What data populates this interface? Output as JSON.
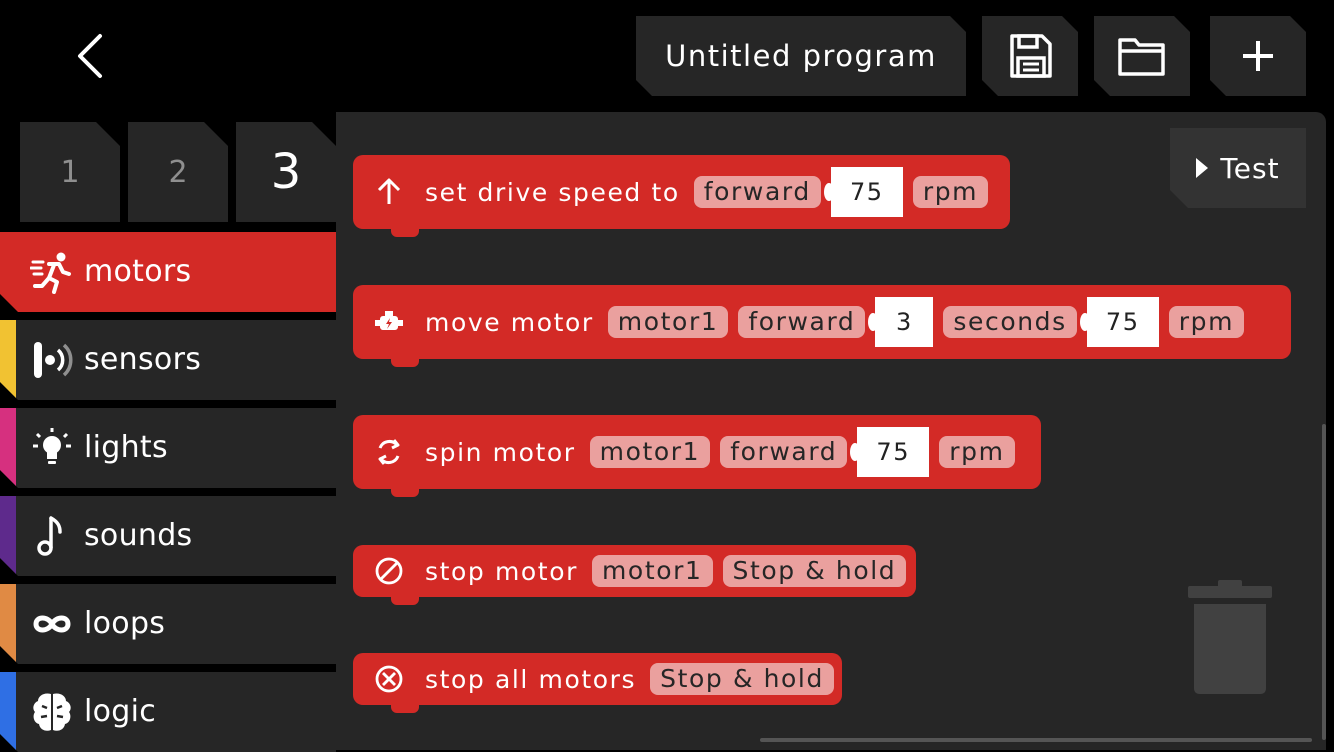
{
  "header": {
    "back_icon": "chevron-left-icon",
    "title": "Untitled program",
    "save_icon": "floppy-disk-icon",
    "open_icon": "folder-icon",
    "new_icon": "plus-icon"
  },
  "pages": [
    {
      "label": "1",
      "active": false
    },
    {
      "label": "2",
      "active": false
    },
    {
      "label": "3",
      "active": true
    }
  ],
  "categories": [
    {
      "label": "motors",
      "icon": "runner-icon",
      "color": "#d32a26",
      "active": true
    },
    {
      "label": "sensors",
      "icon": "sensor-icon",
      "color": "#f1c232"
    },
    {
      "label": "lights",
      "icon": "lightbulb-icon",
      "color": "#d6307f"
    },
    {
      "label": "sounds",
      "icon": "music-note-icon",
      "color": "#5e2a8c"
    },
    {
      "label": "loops",
      "icon": "infinity-icon",
      "color": "#e08a44"
    },
    {
      "label": "logic",
      "icon": "brain-icon",
      "color": "#2f6fe4"
    }
  ],
  "test_button": {
    "label": "Test",
    "icon": "play-icon"
  },
  "blocks": [
    {
      "icon": "arrow-up-icon",
      "text": "set drive speed to",
      "direction": "forward",
      "speed": "75",
      "unit": "rpm"
    },
    {
      "icon": "engine-icon",
      "text": "move motor",
      "motor": "motor1",
      "direction": "forward",
      "duration": "3",
      "duration_unit": "seconds",
      "speed": "75",
      "unit": "rpm"
    },
    {
      "icon": "rotate-icon",
      "text": "spin motor",
      "motor": "motor1",
      "direction": "forward",
      "speed": "75",
      "unit": "rpm"
    },
    {
      "icon": "stop-circle-icon",
      "text": "stop motor",
      "motor": "motor1",
      "mode": "Stop & hold"
    },
    {
      "icon": "stop-all-icon",
      "text": "stop all motors",
      "mode": "Stop & hold"
    }
  ],
  "trash_icon": "trash-icon",
  "colors": {
    "accent": "#d32a26",
    "pill": "#eaa09e",
    "tile": "#262626"
  }
}
